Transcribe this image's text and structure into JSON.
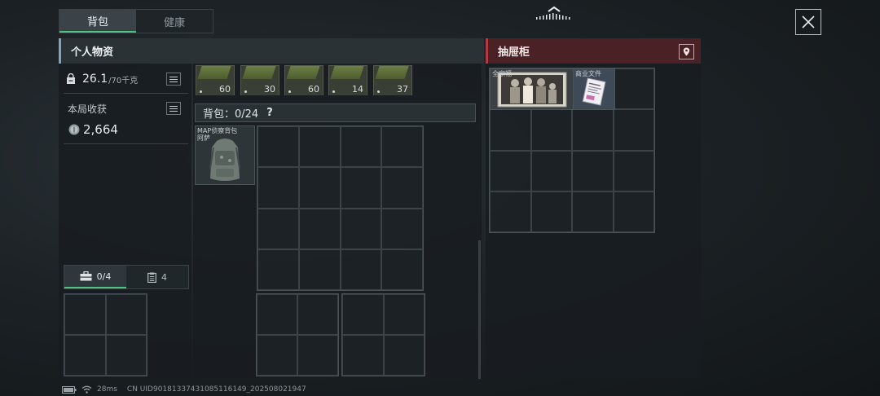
{
  "tabs": [
    {
      "label": "背包"
    },
    {
      "label": "健康"
    }
  ],
  "left_panel": {
    "title": "个人物资",
    "weight_value": "26.1",
    "weight_max": "/70千克",
    "harvest_label": "本局收获",
    "harvest_value": "2,664",
    "bottom_tabs": [
      {
        "label": "0/4",
        "icon": "toolbox-icon"
      },
      {
        "label": "4",
        "icon": "clipboard-icon"
      }
    ]
  },
  "ammo_items": [
    {
      "count": "60"
    },
    {
      "count": "30"
    },
    {
      "count": "60"
    },
    {
      "count": "14"
    },
    {
      "count": "37"
    }
  ],
  "backpack": {
    "label": "背包：0/24",
    "help": "?",
    "item_name_line1": "MAP侦察背包",
    "item_name_line2": "阿萨"
  },
  "drawer": {
    "title": "抽屉柜",
    "items": [
      {
        "name": "全家福"
      },
      {
        "name": "商业文件"
      }
    ]
  },
  "footer": {
    "ping": "28ms",
    "uid": "CN UID9018133743108511614​9_202508021947"
  },
  "colors": {
    "accent": "#4fc27f",
    "drawer_header": "#4a2125"
  }
}
